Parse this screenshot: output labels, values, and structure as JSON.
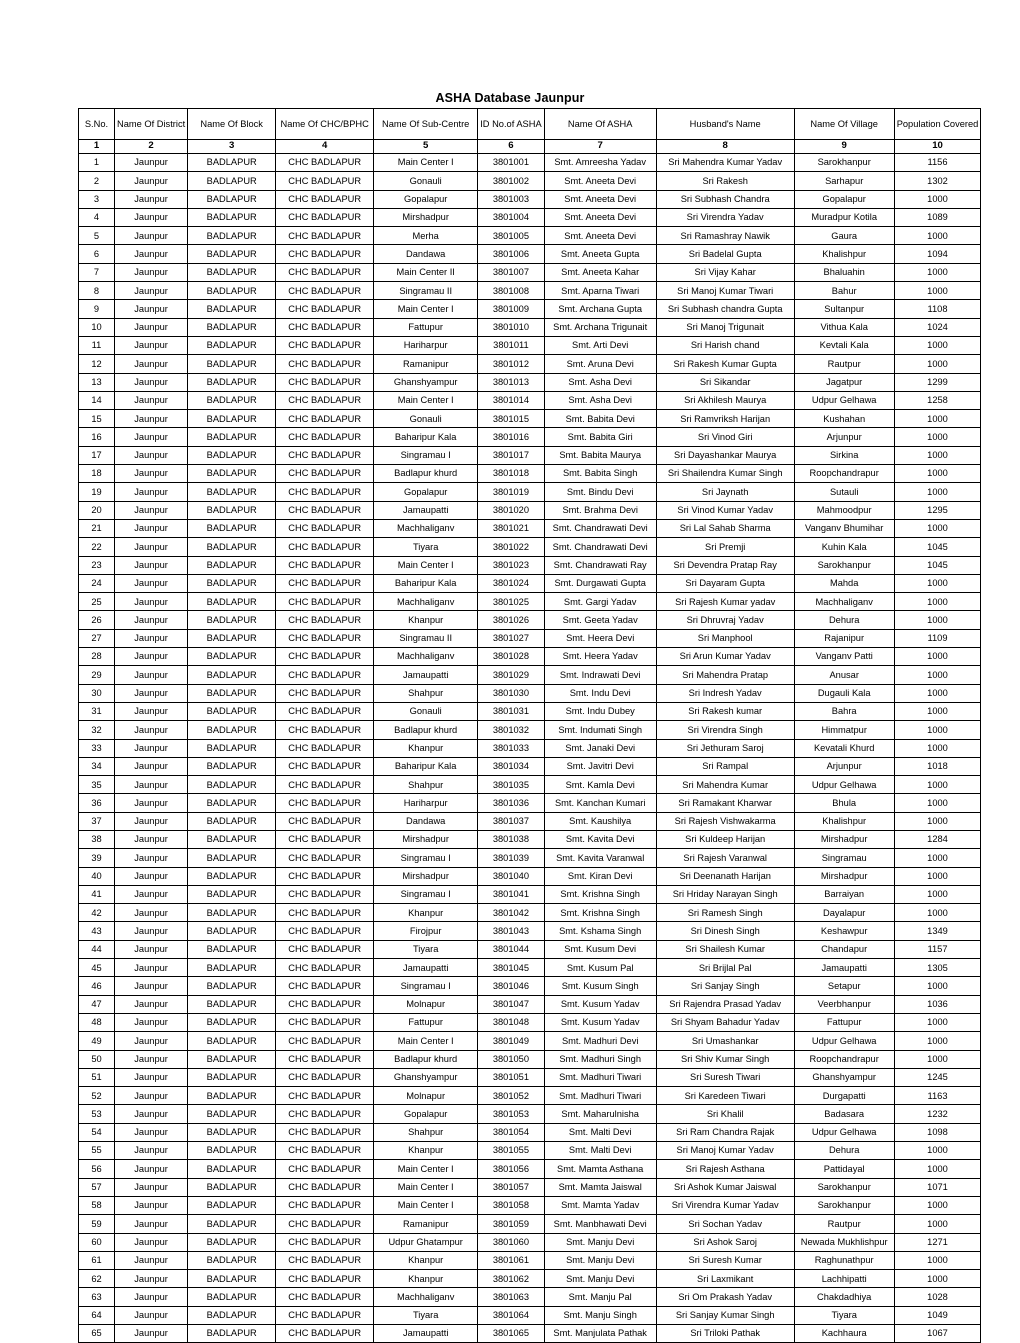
{
  "document": {
    "title": "ASHA Database Jaunpur"
  },
  "table": {
    "headers": [
      "S.No.",
      "Name Of District",
      "Name Of Block",
      "Name Of CHC/BPHC",
      "Name Of Sub-Centre",
      "ID No.of ASHA",
      "Name Of ASHA",
      "Husband's Name",
      "Name Of Village",
      "Population Covered"
    ],
    "column_numbers": [
      "1",
      "2",
      "3",
      "4",
      "5",
      "6",
      "7",
      "8",
      "9",
      "10"
    ],
    "rows": [
      [
        "1",
        "Jaunpur",
        "BADLAPUR",
        "CHC BADLAPUR",
        "Main Center I",
        "3801001",
        "Smt. Amreesha Yadav",
        "Sri Mahendra Kumar Yadav",
        "Sarokhanpur",
        "1156"
      ],
      [
        "2",
        "Jaunpur",
        "BADLAPUR",
        "CHC BADLAPUR",
        "Gonauli",
        "3801002",
        "Smt. Aneeta Devi",
        "Sri Rakesh",
        "Sarhapur",
        "1302"
      ],
      [
        "3",
        "Jaunpur",
        "BADLAPUR",
        "CHC BADLAPUR",
        "Gopalapur",
        "3801003",
        "Smt. Aneeta Devi",
        "Sri Subhash Chandra",
        "Gopalapur",
        "1000"
      ],
      [
        "4",
        "Jaunpur",
        "BADLAPUR",
        "CHC BADLAPUR",
        "Mirshadpur",
        "3801004",
        "Smt. Aneeta Devi",
        "Sri Virendra Yadav",
        "Muradpur Kotila",
        "1089"
      ],
      [
        "5",
        "Jaunpur",
        "BADLAPUR",
        "CHC BADLAPUR",
        "Merha",
        "3801005",
        "Smt. Aneeta Devi",
        "Sri Ramashray Nawik",
        "Gaura",
        "1000"
      ],
      [
        "6",
        "Jaunpur",
        "BADLAPUR",
        "CHC BADLAPUR",
        "Dandawa",
        "3801006",
        "Smt. Aneeta Gupta",
        "Sri Badelal Gupta",
        "Khalishpur",
        "1094"
      ],
      [
        "7",
        "Jaunpur",
        "BADLAPUR",
        "CHC BADLAPUR",
        "Main Center II",
        "3801007",
        "Smt. Aneeta Kahar",
        "Sri Vijay Kahar",
        "Bhaluahin",
        "1000"
      ],
      [
        "8",
        "Jaunpur",
        "BADLAPUR",
        "CHC BADLAPUR",
        "Singramau II",
        "3801008",
        "Smt. Aparna Tiwari",
        "Sri Manoj Kumar Tiwari",
        "Bahur",
        "1000"
      ],
      [
        "9",
        "Jaunpur",
        "BADLAPUR",
        "CHC BADLAPUR",
        "Main Center I",
        "3801009",
        "Smt. Archana Gupta",
        "Sri Subhash chandra Gupta",
        "Sultanpur",
        "1108"
      ],
      [
        "10",
        "Jaunpur",
        "BADLAPUR",
        "CHC BADLAPUR",
        "Fattupur",
        "3801010",
        "Smt. Archana Trigunait",
        "Sri Manoj Trigunait",
        "Vithua Kala",
        "1024"
      ],
      [
        "11",
        "Jaunpur",
        "BADLAPUR",
        "CHC BADLAPUR",
        "Hariharpur",
        "3801011",
        "Smt. Arti Devi",
        "Sri Harish chand",
        "Kevtali Kala",
        "1000"
      ],
      [
        "12",
        "Jaunpur",
        "BADLAPUR",
        "CHC BADLAPUR",
        "Ramanipur",
        "3801012",
        "Smt. Aruna Devi",
        "Sri Rakesh Kumar Gupta",
        "Rautpur",
        "1000"
      ],
      [
        "13",
        "Jaunpur",
        "BADLAPUR",
        "CHC BADLAPUR",
        "Ghanshyampur",
        "3801013",
        "Smt. Asha Devi",
        "Sri  Sikandar",
        "Jagatpur",
        "1299"
      ],
      [
        "14",
        "Jaunpur",
        "BADLAPUR",
        "CHC BADLAPUR",
        "Main Center I",
        "3801014",
        "Smt. Asha Devi",
        "Sri Akhilesh Maurya",
        "Udpur Gelhawa",
        "1258"
      ],
      [
        "15",
        "Jaunpur",
        "BADLAPUR",
        "CHC BADLAPUR",
        "Gonauli",
        "3801015",
        "Smt. Babita Devi",
        "Sri Ramvriksh Harijan",
        "Kushahan",
        "1000"
      ],
      [
        "16",
        "Jaunpur",
        "BADLAPUR",
        "CHC BADLAPUR",
        "Baharipur Kala",
        "3801016",
        "Smt. Babita Giri",
        "Sri Vinod Giri",
        "Arjunpur",
        "1000"
      ],
      [
        "17",
        "Jaunpur",
        "BADLAPUR",
        "CHC BADLAPUR",
        "Singramau I",
        "3801017",
        "Smt. Babita Maurya",
        "Sri Dayashankar Maurya",
        "Sirkina",
        "1000"
      ],
      [
        "18",
        "Jaunpur",
        "BADLAPUR",
        "CHC BADLAPUR",
        "Badlapur khurd",
        "3801018",
        "Smt. Babita Singh",
        "Sri Shailendra Kumar Singh",
        "Roopchandrapur",
        "1000"
      ],
      [
        "19",
        "Jaunpur",
        "BADLAPUR",
        "CHC BADLAPUR",
        "Gopalapur",
        "3801019",
        "Smt. Bindu Devi",
        "Sri Jaynath",
        "Sutauli",
        "1000"
      ],
      [
        "20",
        "Jaunpur",
        "BADLAPUR",
        "CHC BADLAPUR",
        "Jamaupatti",
        "3801020",
        "Smt. Brahma Devi",
        "Sri Vinod Kumar Yadav",
        "Mahmoodpur",
        "1295"
      ],
      [
        "21",
        "Jaunpur",
        "BADLAPUR",
        "CHC BADLAPUR",
        "Machhaliganv",
        "3801021",
        "Smt. Chandrawati Devi",
        "Sri Lal Sahab Sharma",
        "Vanganv Bhumihar",
        "1000"
      ],
      [
        "22",
        "Jaunpur",
        "BADLAPUR",
        "CHC BADLAPUR",
        "Tiyara",
        "3801022",
        "Smt. Chandrawati Devi",
        "Sri Premji",
        "Kuhin Kala",
        "1045"
      ],
      [
        "23",
        "Jaunpur",
        "BADLAPUR",
        "CHC BADLAPUR",
        "Main Center I",
        "3801023",
        "Smt. Chandrawati Ray",
        "Sri Devendra Pratap Ray",
        "Sarokhanpur",
        "1045"
      ],
      [
        "24",
        "Jaunpur",
        "BADLAPUR",
        "CHC BADLAPUR",
        "Baharipur Kala",
        "3801024",
        "Smt. Durgawati Gupta",
        "Sri Dayaram Gupta",
        "Mahda",
        "1000"
      ],
      [
        "25",
        "Jaunpur",
        "BADLAPUR",
        "CHC BADLAPUR",
        "Machhaliganv",
        "3801025",
        "Smt. Gargi Yadav",
        "Sri Rajesh Kumar yadav",
        "Machhaliganv",
        "1000"
      ],
      [
        "26",
        "Jaunpur",
        "BADLAPUR",
        "CHC BADLAPUR",
        "Khanpur",
        "3801026",
        "Smt. Geeta Yadav",
        "Sri Dhruvraj Yadav",
        "Dehura",
        "1000"
      ],
      [
        "27",
        "Jaunpur",
        "BADLAPUR",
        "CHC BADLAPUR",
        "Singramau II",
        "3801027",
        "Smt. Heera Devi",
        "Sri Manphool",
        "Rajanipur",
        "1109"
      ],
      [
        "28",
        "Jaunpur",
        "BADLAPUR",
        "CHC BADLAPUR",
        "Machhaliganv",
        "3801028",
        "Smt. Heera Yadav",
        "Sri Arun Kumar Yadav",
        "Vanganv Patti",
        "1000"
      ],
      [
        "29",
        "Jaunpur",
        "BADLAPUR",
        "CHC BADLAPUR",
        "Jamaupatti",
        "3801029",
        "Smt. Indrawati Devi",
        "Sri Mahendra Pratap",
        "Anusar",
        "1000"
      ],
      [
        "30",
        "Jaunpur",
        "BADLAPUR",
        "CHC BADLAPUR",
        "Shahpur",
        "3801030",
        "Smt. Indu Devi",
        "Sri Indresh Yadav",
        "Dugauli Kala",
        "1000"
      ],
      [
        "31",
        "Jaunpur",
        "BADLAPUR",
        "CHC BADLAPUR",
        "Gonauli",
        "3801031",
        "Smt. Indu Dubey",
        "Sri Rakesh kumar",
        "Bahra",
        "1000"
      ],
      [
        "32",
        "Jaunpur",
        "BADLAPUR",
        "CHC BADLAPUR",
        "Badlapur khurd",
        "3801032",
        "Smt. Indumati Singh",
        "Sri Virendra Singh",
        "Himmatpur",
        "1000"
      ],
      [
        "33",
        "Jaunpur",
        "BADLAPUR",
        "CHC BADLAPUR",
        "Khanpur",
        "3801033",
        "Smt. Janaki Devi",
        "Sri Jethuram Saroj",
        "Kevatali Khurd",
        "1000"
      ],
      [
        "34",
        "Jaunpur",
        "BADLAPUR",
        "CHC BADLAPUR",
        "Baharipur Kala",
        "3801034",
        "Smt. Javitri Devi",
        "Sri Rampal",
        "Arjunpur",
        "1018"
      ],
      [
        "35",
        "Jaunpur",
        "BADLAPUR",
        "CHC BADLAPUR",
        "Shahpur",
        "3801035",
        "Smt. Kamla Devi",
        "Sri Mahendra Kumar",
        "Udpur Gelhawa",
        "1000"
      ],
      [
        "36",
        "Jaunpur",
        "BADLAPUR",
        "CHC BADLAPUR",
        "Hariharpur",
        "3801036",
        "Smt. Kanchan Kumari",
        "Sri Ramakant Kharwar",
        "Bhula",
        "1000"
      ],
      [
        "37",
        "Jaunpur",
        "BADLAPUR",
        "CHC BADLAPUR",
        "Dandawa",
        "3801037",
        "Smt. Kaushilya",
        "Sri Rajesh Vishwakarma",
        "Khalishpur",
        "1000"
      ],
      [
        "38",
        "Jaunpur",
        "BADLAPUR",
        "CHC BADLAPUR",
        "Mirshadpur",
        "3801038",
        "Smt. Kavita Devi",
        "Sri Kuldeep Harijan",
        "Mirshadpur",
        "1284"
      ],
      [
        "39",
        "Jaunpur",
        "BADLAPUR",
        "CHC BADLAPUR",
        "Singramau I",
        "3801039",
        "Smt. Kavita Varanwal",
        "Sri Rajesh Varanwal",
        "Singramau",
        "1000"
      ],
      [
        "40",
        "Jaunpur",
        "BADLAPUR",
        "CHC BADLAPUR",
        "Mirshadpur",
        "3801040",
        "Smt. Kiran Devi",
        "Sri Deenanath Harijan",
        "Mirshadpur",
        "1000"
      ],
      [
        "41",
        "Jaunpur",
        "BADLAPUR",
        "CHC BADLAPUR",
        "Singramau I",
        "3801041",
        "Smt. Krishna Singh",
        "Sri Hriday Narayan Singh",
        "Barraiyan",
        "1000"
      ],
      [
        "42",
        "Jaunpur",
        "BADLAPUR",
        "CHC BADLAPUR",
        "Khanpur",
        "3801042",
        "Smt. Krishna Singh",
        "Sri Ramesh Singh",
        "Dayalapur",
        "1000"
      ],
      [
        "43",
        "Jaunpur",
        "BADLAPUR",
        "CHC BADLAPUR",
        "Firojpur",
        "3801043",
        "Smt. Kshama Singh",
        "Sri Dinesh Singh",
        "Keshawpur",
        "1349"
      ],
      [
        "44",
        "Jaunpur",
        "BADLAPUR",
        "CHC BADLAPUR",
        "Tiyara",
        "3801044",
        "Smt. Kusum Devi",
        "Sri Shailesh Kumar",
        "Chandapur",
        "1157"
      ],
      [
        "45",
        "Jaunpur",
        "BADLAPUR",
        "CHC BADLAPUR",
        "Jamaupatti",
        "3801045",
        "Smt. Kusum Pal",
        "Sri Brijlal Pal",
        "Jamaupatti",
        "1305"
      ],
      [
        "46",
        "Jaunpur",
        "BADLAPUR",
        "CHC BADLAPUR",
        "Singramau I",
        "3801046",
        "Smt. Kusum Singh",
        "Sri Sanjay Singh",
        "Setapur",
        "1000"
      ],
      [
        "47",
        "Jaunpur",
        "BADLAPUR",
        "CHC BADLAPUR",
        "Molnapur",
        "3801047",
        "Smt. Kusum Yadav",
        "Sri Rajendra Prasad Yadav",
        "Veerbhanpur",
        "1036"
      ],
      [
        "48",
        "Jaunpur",
        "BADLAPUR",
        "CHC BADLAPUR",
        "Fattupur",
        "3801048",
        "Smt. Kusum Yadav",
        "Sri Shyam Bahadur Yadav",
        "Fattupur",
        "1000"
      ],
      [
        "49",
        "Jaunpur",
        "BADLAPUR",
        "CHC BADLAPUR",
        "Main Center I",
        "3801049",
        "Smt. Madhuri Devi",
        "Sri Umashankar",
        "Udpur Gelhawa",
        "1000"
      ],
      [
        "50",
        "Jaunpur",
        "BADLAPUR",
        "CHC BADLAPUR",
        "Badlapur khurd",
        "3801050",
        "Smt. Madhuri Singh",
        "Sri Shiv Kumar Singh",
        "Roopchandrapur",
        "1000"
      ],
      [
        "51",
        "Jaunpur",
        "BADLAPUR",
        "CHC BADLAPUR",
        "Ghanshyampur",
        "3801051",
        "Smt. Madhuri Tiwari",
        "Sri Suresh Tiwari",
        "Ghanshyampur",
        "1245"
      ],
      [
        "52",
        "Jaunpur",
        "BADLAPUR",
        "CHC BADLAPUR",
        "Molnapur",
        "3801052",
        "Smt. Madhuri Tiwari",
        "Sri Karedeen Tiwari",
        "Durgapatti",
        "1163"
      ],
      [
        "53",
        "Jaunpur",
        "BADLAPUR",
        "CHC BADLAPUR",
        "Gopalapur",
        "3801053",
        "Smt. Maharulnisha",
        "Sri  Khalil",
        "Badasara",
        "1232"
      ],
      [
        "54",
        "Jaunpur",
        "BADLAPUR",
        "CHC BADLAPUR",
        "Shahpur",
        "3801054",
        "Smt. Malti Devi",
        "Sri Ram Chandra Rajak",
        "Udpur Gelhawa",
        "1098"
      ],
      [
        "55",
        "Jaunpur",
        "BADLAPUR",
        "CHC BADLAPUR",
        "Khanpur",
        "3801055",
        "Smt. Malti Devi",
        "Sri Manoj Kumar Yadav",
        "Dehura",
        "1000"
      ],
      [
        "56",
        "Jaunpur",
        "BADLAPUR",
        "CHC BADLAPUR",
        "Main Center I",
        "3801056",
        "Smt. Mamta Asthana",
        "Sri Rajesh Asthana",
        "Pattidayal",
        "1000"
      ],
      [
        "57",
        "Jaunpur",
        "BADLAPUR",
        "CHC BADLAPUR",
        "Main Center I",
        "3801057",
        "Smt. Mamta Jaiswal",
        "Sri Ashok Kumar Jaiswal",
        "Sarokhanpur",
        "1071"
      ],
      [
        "58",
        "Jaunpur",
        "BADLAPUR",
        "CHC BADLAPUR",
        "Main Center I",
        "3801058",
        "Smt. Mamta Yadav",
        "Sri Virendra Kumar Yadav",
        "Sarokhanpur",
        "1000"
      ],
      [
        "59",
        "Jaunpur",
        "BADLAPUR",
        "CHC BADLAPUR",
        "Ramanipur",
        "3801059",
        "Smt. Manbhawati Devi",
        "Sri Sochan Yadav",
        "Rautpur",
        "1000"
      ],
      [
        "60",
        "Jaunpur",
        "BADLAPUR",
        "CHC BADLAPUR",
        "Udpur Ghatampur",
        "3801060",
        "Smt. Manju Devi",
        "Sri Ashok Saroj",
        "Newada Mukhlishpur",
        "1271"
      ],
      [
        "61",
        "Jaunpur",
        "BADLAPUR",
        "CHC BADLAPUR",
        "Khanpur",
        "3801061",
        "Smt. Manju Devi",
        "Sri Suresh Kumar",
        "Raghunathpur",
        "1000"
      ],
      [
        "62",
        "Jaunpur",
        "BADLAPUR",
        "CHC BADLAPUR",
        "Khanpur",
        "3801062",
        "Smt. Manju Devi",
        "Sri Laxmikant",
        "Lachhipatti",
        "1000"
      ],
      [
        "63",
        "Jaunpur",
        "BADLAPUR",
        "CHC BADLAPUR",
        "Machhaliganv",
        "3801063",
        "Smt. Manju Pal",
        "Sri Om Prakash Yadav",
        "Chakdadhiya",
        "1028"
      ],
      [
        "64",
        "Jaunpur",
        "BADLAPUR",
        "CHC BADLAPUR",
        "Tiyara",
        "3801064",
        "Smt. Manju Singh",
        "Sri Sanjay Kumar Singh",
        "Tiyara",
        "1049"
      ],
      [
        "65",
        "Jaunpur",
        "BADLAPUR",
        "CHC BADLAPUR",
        "Jamaupatti",
        "3801065",
        "Smt. Manjulata Pathak",
        "Sri Triloki Pathak",
        "Kachhaura",
        "1067"
      ]
    ]
  }
}
